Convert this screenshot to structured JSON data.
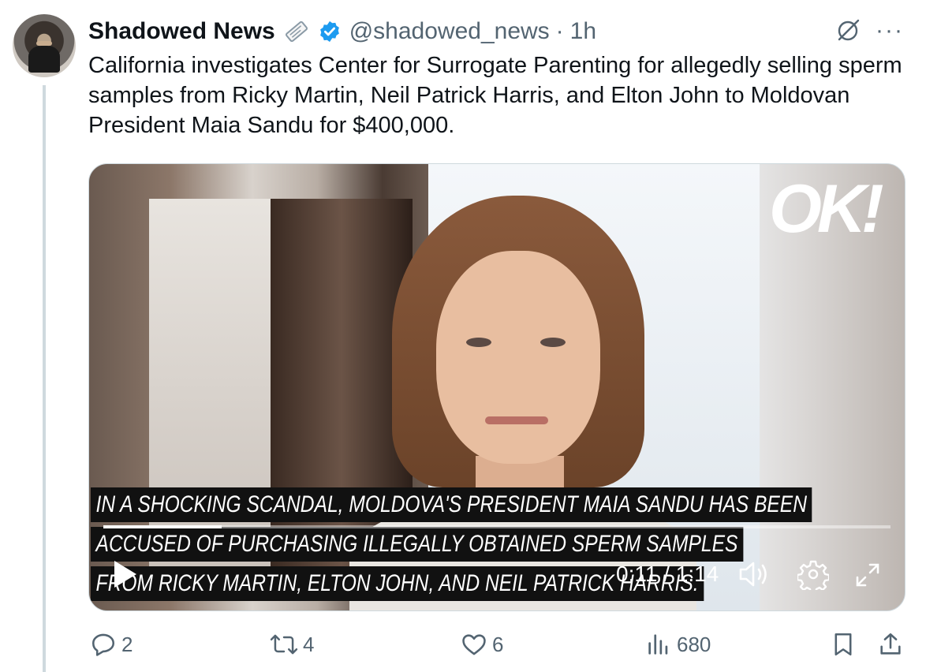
{
  "tweet": {
    "author_name": "Shadowed News",
    "handle": "@shadowed_news",
    "separator": "·",
    "time": "1h",
    "text": "California investigates Center for Surrogate Parenting for allegedly selling sperm samples from Ricky Martin, Neil Patrick Harris, and Elton John to Moldovan President Maia Sandu for $400,000.",
    "more_label": "···"
  },
  "media": {
    "logo_text": "OK!",
    "captions": [
      "IN A SHOCKING SCANDAL, MOLDOVA'S PRESIDENT MAIA SANDU HAS BEEN",
      "ACCUSED OF PURCHASING ILLEGALLY OBTAINED SPERM SAMPLES",
      "FROM RICKY MARTIN, ELTON JOHN, AND NEIL PATRICK HARRIS."
    ],
    "timecode": "0:11 / 1:14",
    "progress": 0.15
  },
  "actions": {
    "replies": "2",
    "reposts": "4",
    "likes": "6",
    "views": "680"
  },
  "colors": {
    "verified": "#1d9bf0",
    "muted": "#536471",
    "text": "#0f1419"
  }
}
